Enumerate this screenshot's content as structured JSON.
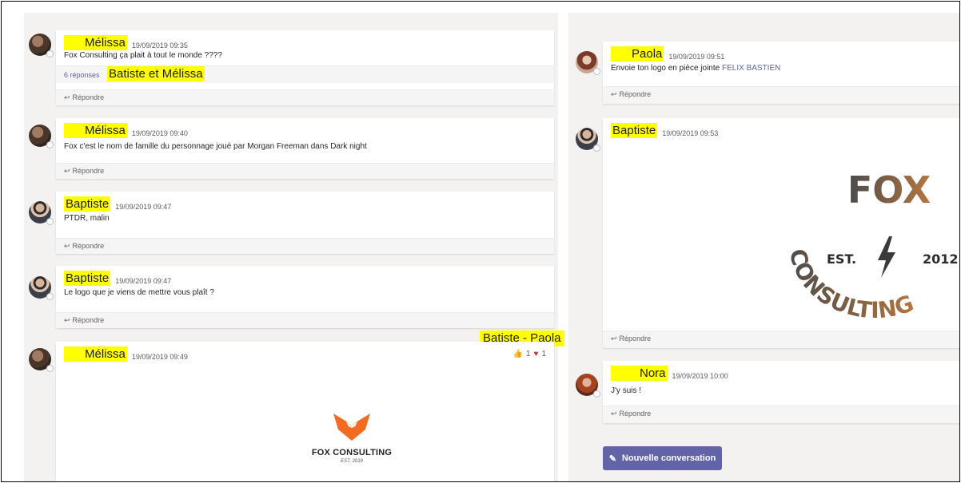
{
  "left_thread": [
    {
      "author": "Mélissa",
      "time": "19/09/2019 09:35",
      "text": "Fox Consulting ça plait à tout le monde ????",
      "replies_count": "6 réponses",
      "replies_names": "Batiste et Mélissa",
      "reply_label": "Répondre"
    },
    {
      "author": "Mélissa",
      "time": "19/09/2019 09:40",
      "text": "Fox c'est le nom de famille du personnage joué par Morgan Freeman dans Dark night",
      "reply_label": "Répondre"
    },
    {
      "author": "Baptiste",
      "time": "19/09/2019 09:47",
      "text": "PTDR, malin",
      "reply_label": "Répondre"
    },
    {
      "author": "Baptiste",
      "time": "19/09/2019 09:47",
      "text": "Le logo que je viens de mettre vous plaît ?",
      "reply_label": "Répondre"
    },
    {
      "author": "Mélissa",
      "time": "19/09/2019 09:49",
      "reactions": {
        "like_count": "1",
        "heart_count": "1",
        "label": "Batiste - Paola"
      },
      "logo_title": "FOX CONSULTING",
      "logo_sub": "EST. 2019"
    }
  ],
  "right_thread": [
    {
      "author": "Paola",
      "time": "19/09/2019 09:51",
      "text": "Envoie ton logo en pièce jointe",
      "mention": "FELIX BASTIEN",
      "reply_label": "Répondre"
    },
    {
      "author": "Baptiste",
      "time": "19/09/2019 09:53",
      "logo": {
        "word": "FOX",
        "arc": "CONSULTING",
        "est": "EST.",
        "year": "2012"
      },
      "reply_label": "Répondre"
    },
    {
      "author": "Nora",
      "time": "19/09/2019 10:00",
      "text": "J'y suis !",
      "reply_label": "Répondre"
    }
  ],
  "new_conversation_label": "Nouvelle conversation",
  "colors": {
    "accent": "#6264a7",
    "highlight": "#ffff00",
    "heart": "#d13438"
  }
}
